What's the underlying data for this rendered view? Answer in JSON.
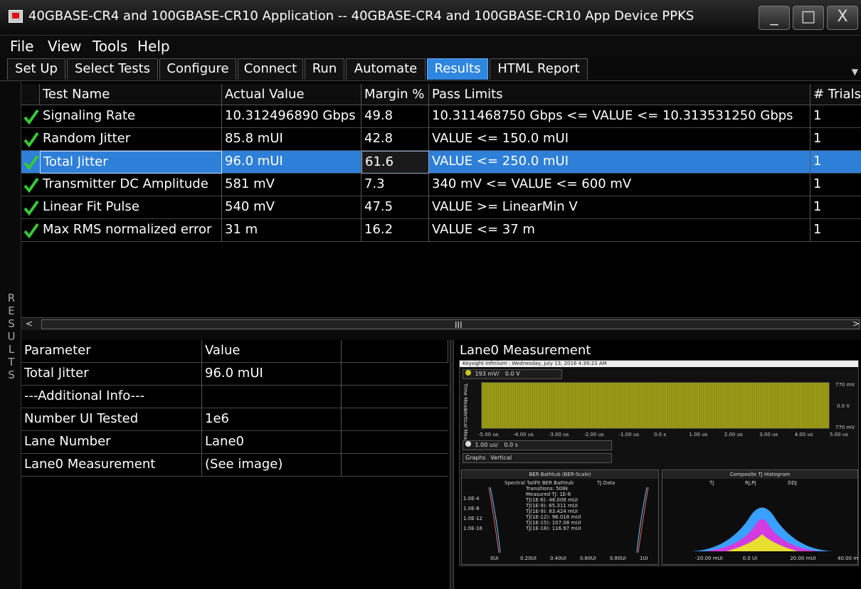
{
  "window": {
    "title": "40GBASE-CR4 and 100GBASE-CR10 Application -- 40GBASE-CR4 and 100GBASE-CR10 App Device PPKS",
    "minimize": "_",
    "maximize": "□",
    "close": "X"
  },
  "menu": [
    "File",
    "View",
    "Tools",
    "Help"
  ],
  "tabs": [
    {
      "label": "Set Up"
    },
    {
      "label": "Select Tests"
    },
    {
      "label": "Configure"
    },
    {
      "label": "Connect"
    },
    {
      "label": "Run"
    },
    {
      "label": "Automate"
    },
    {
      "label": "Results",
      "active": true
    },
    {
      "label": "HTML Report"
    }
  ],
  "side_label": "RESULTS",
  "results_table": {
    "headers": [
      "Test Name",
      "Actual Value",
      "Margin %",
      "Pass Limits",
      "# Trials"
    ],
    "rows": [
      {
        "status": "pass",
        "name": "Signaling Rate",
        "actual": "10.312496890 Gbps",
        "margin": "49.8",
        "limits": "10.311468750 Gbps <= VALUE <= 10.313531250 Gbps",
        "trials": "1"
      },
      {
        "status": "pass",
        "name": "Random Jitter",
        "actual": "85.8 mUI",
        "margin": "42.8",
        "limits": "VALUE <= 150.0 mUI",
        "trials": "1"
      },
      {
        "status": "pass",
        "name": "Total Jitter",
        "actual": "96.0 mUI",
        "margin": "61.6",
        "limits": "VALUE <= 250.0 mUI",
        "trials": "1",
        "selected": true
      },
      {
        "status": "pass",
        "name": "Transmitter DC Amplitude",
        "actual": "581 mV",
        "margin": "7.3",
        "limits": "340 mV <= VALUE <= 600 mV",
        "trials": "1"
      },
      {
        "status": "pass",
        "name": "Linear Fit Pulse",
        "actual": "540 mV",
        "margin": "47.5",
        "limits": "VALUE >= LinearMin V",
        "trials": "1"
      },
      {
        "status": "pass",
        "name": "Max RMS normalized error",
        "actual": "31 m",
        "margin": "16.2",
        "limits": "VALUE <= 37 m",
        "trials": "1"
      }
    ]
  },
  "scrollbar": {
    "left": "<",
    "right": ">",
    "grip": "III"
  },
  "param_table": {
    "headers": [
      "Parameter",
      "Value"
    ],
    "rows": [
      {
        "param": "Total Jitter",
        "value": "96.0 mUI"
      },
      {
        "param": "---Additional Info---",
        "value": ""
      },
      {
        "param": "Number UI Tested",
        "value": "1e6"
      },
      {
        "param": "Lane Number",
        "value": "Lane0"
      },
      {
        "param": "Lane0 Measurement",
        "value": "(See image)"
      }
    ]
  },
  "image_panel": {
    "title": "Lane0 Measurement",
    "scope_header": "Keysight Infiniium : Wednesday, July 13, 2016 4:39:23 AM",
    "vscale": "193 mV/",
    "voffset": "0.0 V",
    "hscale": "1.00 us/",
    "hoffset": "0.0 s",
    "graphs_label": "Graphs",
    "graphs_value": "Vertical",
    "side_labels": [
      "Time Meas",
      "Vertical Meas"
    ],
    "right_ticks": [
      "770 mV",
      "0.0 V",
      "770 mV"
    ],
    "time_ticks": [
      "-5.00 us",
      "-4.00 us",
      "-3.00 us",
      "-2.00 us",
      "-1.00 us",
      "0.0 s",
      "1.00 us",
      "2.00 us",
      "3.00 us",
      "4.00 us",
      "5.00 us"
    ],
    "bathtub": {
      "title": "BER Bathtub (BER-Scale)",
      "legend": [
        "Spectral TailFit BER Bathtub",
        "TJ Data"
      ],
      "yticks": [
        "1.0E-4",
        "1.0E-8",
        "1.0E-12",
        "1.0E-16"
      ],
      "xticks": [
        "0UI",
        "0.20UI",
        "0.40UI",
        "0.60UI",
        "0.80UI",
        "1UI"
      ],
      "notes": [
        "Transitions: 508k",
        "Measured TJ: 1E-6",
        "TJ(1E-6): 48.008 mUI",
        "TJ(1E-9): 65.311 mUI",
        "TJ(1E-9): 83.424 mUI",
        "TJ(1E-12): 96.018 mUI",
        "TJ(1E-15): 107.08 mUI",
        "TJ(1E-18): 116.97 mUI"
      ]
    },
    "histogram": {
      "title": "Composite TJ Histogram",
      "legend": [
        "TJ",
        "RJ,PJ",
        "DDJ"
      ],
      "xticks": [
        "-20.00 mUI",
        "0.0 UI",
        "20.00 mUI",
        "40.00 mUI"
      ]
    }
  },
  "colors": {
    "accent": "#2e86de",
    "pass": "#37c837",
    "wave": "#a3a320"
  }
}
